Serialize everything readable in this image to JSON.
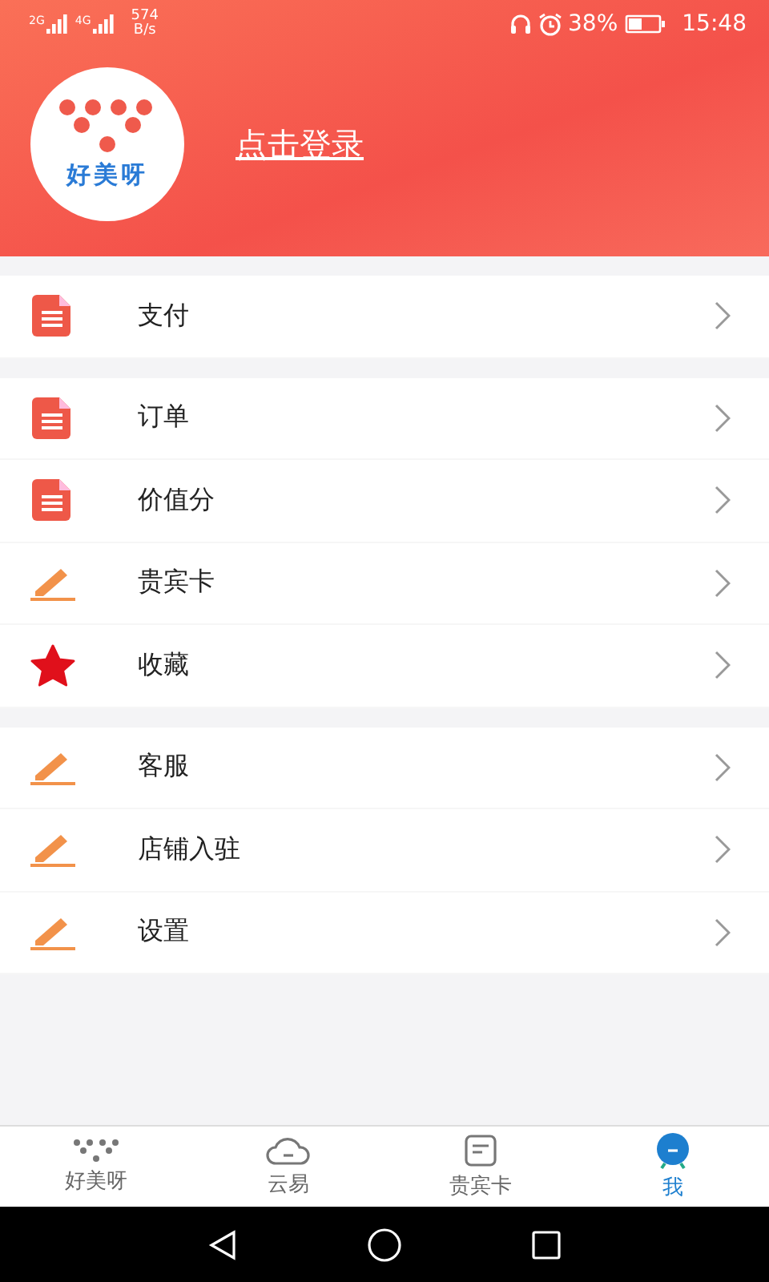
{
  "status_bar": {
    "signal_1": "2G",
    "signal_2": "4G",
    "speed": "574",
    "speed_unit": "B/s",
    "battery": "38%",
    "time": "15:48"
  },
  "profile": {
    "avatar_text": "好美呀",
    "login": "点击登录"
  },
  "menu_groups": [
    {
      "items": [
        {
          "label": "支付",
          "kind": "document"
        }
      ]
    },
    {
      "items": [
        {
          "label": "订单",
          "kind": "document"
        },
        {
          "label": "价值分",
          "kind": "document"
        },
        {
          "label": "贵宾卡",
          "kind": "pen"
        },
        {
          "label": "收藏",
          "kind": "star"
        }
      ]
    },
    {
      "items": [
        {
          "label": "客服",
          "kind": "pen"
        },
        {
          "label": "店铺入驻",
          "kind": "pen"
        },
        {
          "label": "设置",
          "kind": "pen"
        }
      ]
    }
  ],
  "tab_bar": [
    {
      "label": "好美呀",
      "kind": "dots",
      "selected": false
    },
    {
      "label": "云易",
      "kind": "cloud",
      "selected": false
    },
    {
      "label": "贵宾卡",
      "kind": "card",
      "selected": false
    },
    {
      "label": "我",
      "kind": "me",
      "selected": true
    }
  ]
}
